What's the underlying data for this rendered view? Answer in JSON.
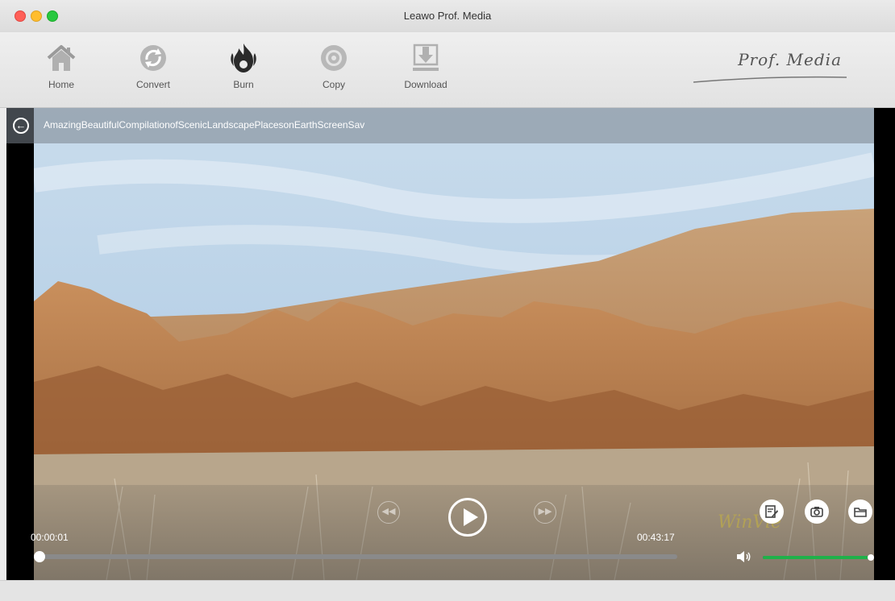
{
  "window": {
    "title": "Leawo Prof. Media"
  },
  "toolbar": {
    "items": [
      {
        "label": "Home",
        "icon": "home-icon"
      },
      {
        "label": "Convert",
        "icon": "convert-icon"
      },
      {
        "label": "Burn",
        "icon": "burn-icon"
      },
      {
        "label": "Copy",
        "icon": "copy-icon"
      },
      {
        "label": "Download",
        "icon": "download-icon"
      }
    ],
    "brand": "Prof. Media"
  },
  "player": {
    "video_title": "AmazingBeautifulCompilationofScenicLandscapePlacesonEarthScreenSav",
    "current_time": "00:00:01",
    "total_time": "00:43:17",
    "progress_fraction": 0.0004,
    "volume_fraction": 1.0,
    "watermark": "WinVie"
  },
  "colors": {
    "volume_accent": "#1fb14a",
    "traffic_red": "#ff5f57",
    "traffic_yellow": "#ffbd2e",
    "traffic_green": "#28c840"
  }
}
